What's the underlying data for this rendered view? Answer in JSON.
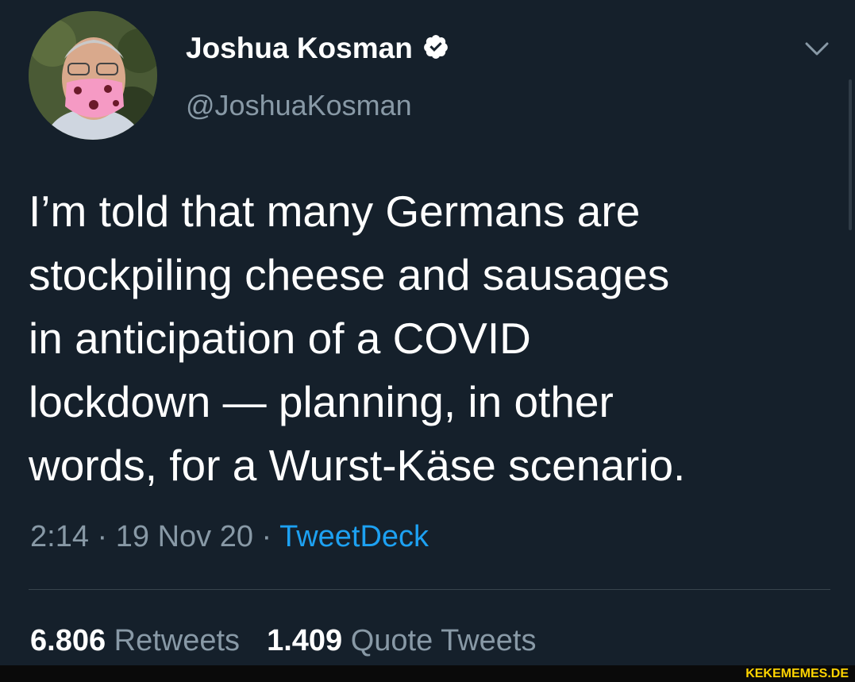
{
  "user": {
    "display_name": "Joshua Kosman",
    "handle": "@JoshuaKosman",
    "verified": true
  },
  "icons": {
    "verified": "verified-badge-icon",
    "menu": "chevron-down-icon"
  },
  "tweet": {
    "text": "I’m told that many Germans are\nstockpiling cheese and sausages\nin anticipation of a COVID\nlockdown — planning, in other\nwords, for a Wurst-Käse scenario.",
    "time": "2:14",
    "date": "19 Nov 20",
    "separator": "·",
    "source": "TweetDeck"
  },
  "stats": {
    "retweets_count": "6.806",
    "retweets_label": "Retweets",
    "quotes_count": "1.409",
    "quotes_label": "Quote Tweets"
  },
  "watermark": "KEKEMEMES.DE",
  "colors": {
    "background": "#15202b",
    "text": "#ffffff",
    "secondary": "#8899a6",
    "link": "#1da1f2",
    "watermark": "#ffd400"
  }
}
